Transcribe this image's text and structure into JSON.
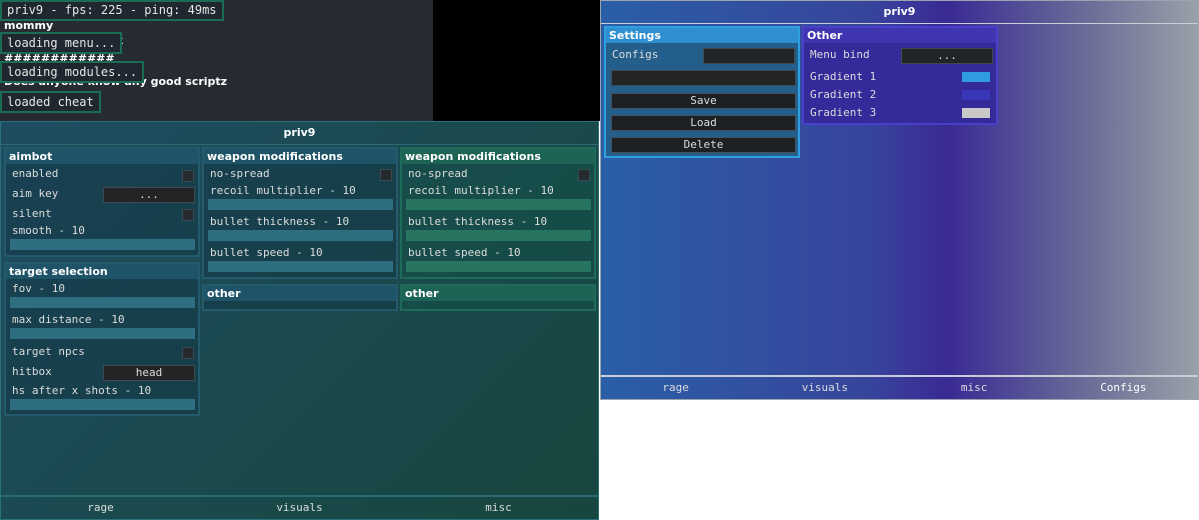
{
  "overlay": {
    "status": "priv9 - fps: 225 - ping: 49ms",
    "chat": [
      "mommy",
      "lk",
      "############",
      "Does anyone know any good scriptz"
    ],
    "notifications": [
      "loading menu...",
      "loading modules...",
      "loaded cheat"
    ]
  },
  "left_window": {
    "title": "priv9",
    "aimbot": {
      "title": "aimbot",
      "enabled": "enabled",
      "aim_key": "aim key",
      "aim_key_value": "...",
      "silent": "silent",
      "smooth": "smooth - 10",
      "smooth_value": 10
    },
    "target_selection": {
      "title": "target selection",
      "fov": "fov - 10",
      "max_distance": "max distance - 10",
      "target_npcs": "target npcs",
      "hitbox": "hitbox",
      "hitbox_value": "head",
      "hs_after": "hs after x shots - 10"
    },
    "weapon_mods": [
      {
        "title": "weapon modifications",
        "no_spread": "no-spread",
        "recoil": "recoil multiplier - 10",
        "thickness": "bullet thickness - 10",
        "speed": "bullet speed - 10"
      },
      {
        "title": "weapon modifications",
        "no_spread": "no-spread",
        "recoil": "recoil multiplier - 10",
        "thickness": "bullet thickness - 10",
        "speed": "bullet speed - 10"
      }
    ],
    "other": [
      "other",
      "other"
    ],
    "tabs": [
      "rage",
      "visuals",
      "misc"
    ]
  },
  "right_window": {
    "title": "priv9",
    "settings": {
      "title": "Settings",
      "configs_label": "Configs",
      "save": "Save",
      "load": "Load",
      "delete": "Delete"
    },
    "other": {
      "title": "Other",
      "menu_bind": "Menu bind",
      "menu_bind_value": "...",
      "gradient1": "Gradient 1",
      "gradient2": "Gradient 2",
      "gradient3": "Gradient 3",
      "gradient1_color": "#2f9be0",
      "gradient2_color": "#3a36b8",
      "gradient3_color": "#c8c8c8"
    },
    "tabs": [
      "rage",
      "visuals",
      "misc",
      "Configs"
    ]
  }
}
